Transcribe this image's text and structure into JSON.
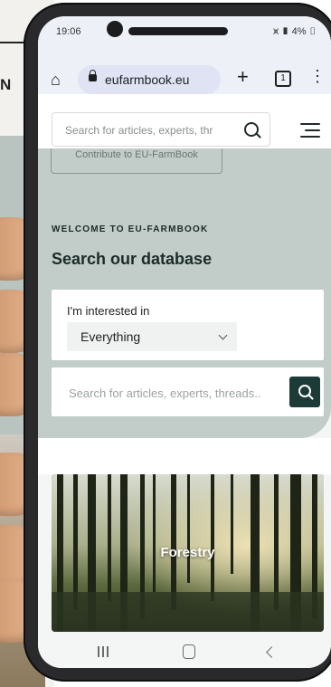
{
  "status_bar": {
    "time": "19:06",
    "battery": "4%"
  },
  "browser": {
    "url": "eufarmbook.eu",
    "tab_count": "1"
  },
  "site_header": {
    "search_placeholder": "Search for articles, experts, thr"
  },
  "hero": {
    "contribute_label": "Contribute to EU-FarmBook",
    "kicker": "WELCOME TO EU-FARMBOOK",
    "title": "Search our database",
    "filter_label": "I'm interested in",
    "filter_value": "Everything",
    "search_placeholder": "Search for articles, experts, threads.."
  },
  "category_card": {
    "label": "Forestry"
  },
  "background": {
    "heading_fragment": "N"
  },
  "colors": {
    "hero_bg": "#c2ccc8",
    "accent": "#1c3a38",
    "chrome": "#eef0f8"
  }
}
